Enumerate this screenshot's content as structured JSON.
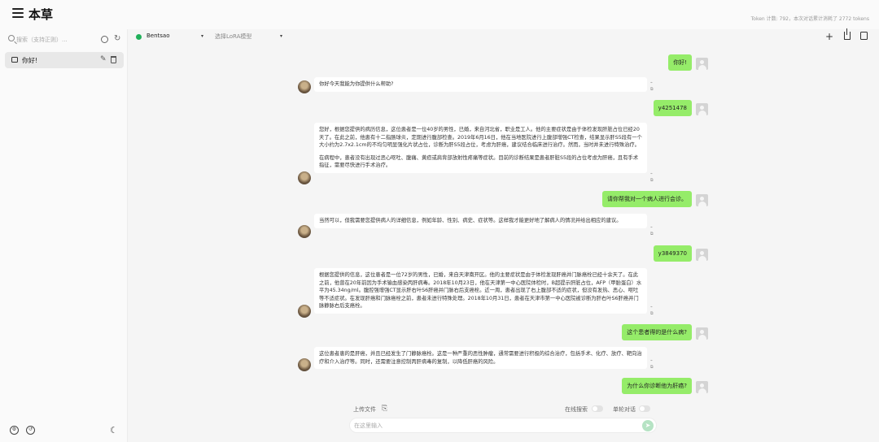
{
  "app": {
    "title": "本草"
  },
  "token_info": "Token 计数: 792，本次对话累计消耗了 2772 tokens",
  "sidebar": {
    "search_placeholder": "搜索（支持正则）...",
    "chats": [
      {
        "label": "你好!"
      }
    ]
  },
  "header": {
    "model": "Bentsao",
    "lora": "选择LoRA模型"
  },
  "messages": [
    {
      "role": "user",
      "text": "你好!"
    },
    {
      "role": "assistant",
      "paragraphs": [
        "你好今天我能为你提供什么帮助?"
      ]
    },
    {
      "role": "user",
      "text": "y4251478"
    },
    {
      "role": "assistant",
      "paragraphs": [
        "您好，根据您提供的病历信息，这位患者是一位40岁的男性，已婚，来自河北省，职业是工人。他的主要症状是由于体检发现肝脏占位已经20天了。在此之前，他患有十二指肠球炎，定期进行腹部检查。2019年6月16日，他在当地医院进行上腹部增强CT检查，结果显示肝S5段有一个大小约为2.7x2.1cm的不均匀明显强化片状占位，诊断为肝S5段占位，考虑为肝癌，建议结合临床进行治疗。然而，当时并未进行特殊治疗。",
        "在病程中，患者没有出现过恶心呕吐、腹痛、黄疸或肩背部放射性疼痛等症状。目前的诊断结果是患者肝脏S5段的占位考虑为肝癌，且有手术指征，需要尽快进行手术治疗。"
      ]
    },
    {
      "role": "user",
      "text": "请你帮我对一个病人进行会诊。"
    },
    {
      "role": "assistant",
      "paragraphs": [
        "当然可以，但我需要您提供病人的详细信息，例如年龄、性别、病史、症状等。这样我才能更好地了解病人的情况并给出相应的建议。"
      ]
    },
    {
      "role": "user",
      "text": "y3849370"
    },
    {
      "role": "assistant",
      "paragraphs": [
        "根据您提供的信息，这位患者是一位72岁的男性，已婚，来自天津南开区。他的主要症状是由于体检发现肝癌并门脉癌栓已经十余天了。在此之前，他曾在20年前因为手术输血感染丙肝病毒。2018年10月23日，他在天津第一中心医院体检时，B超提示肝脏占位，AFP（甲胎蛋白）水平为45.34ng/ml。腹腔强增强CT显示肝右叶S6肝癌并门脉右后支癌栓。近一周，患者出现了右上腹部不适的症状，但没有发热、恶心、呕吐等不适症状。在发现肝癌和门脉癌栓之前，患者未进行特殊处理。2018年10月31日，患者在天津市第一中心医院被诊断为肝右叶S6肝癌并门脉静脉右后支癌栓。"
      ]
    },
    {
      "role": "user",
      "text": "这个患者得的是什么病?"
    },
    {
      "role": "assistant",
      "paragraphs": [
        "这位患者患的是肝癌，并且已经发生了门静脉癌栓。这是一种严重的恶性肿瘤，通常需要进行积极的综合治疗，包括手术、化疗、放疗、靶向治疗和介入治疗等。同时，还需要注意控制丙肝病毒的复制，以降低肝癌的风险。"
      ]
    },
    {
      "role": "user",
      "text": "为什么你诊断他为肝癌?"
    }
  ],
  "input": {
    "upload_label": "上传文件",
    "online_search_label": "在线搜索",
    "single_turn_label": "单轮对话",
    "placeholder": "在这里输入"
  }
}
